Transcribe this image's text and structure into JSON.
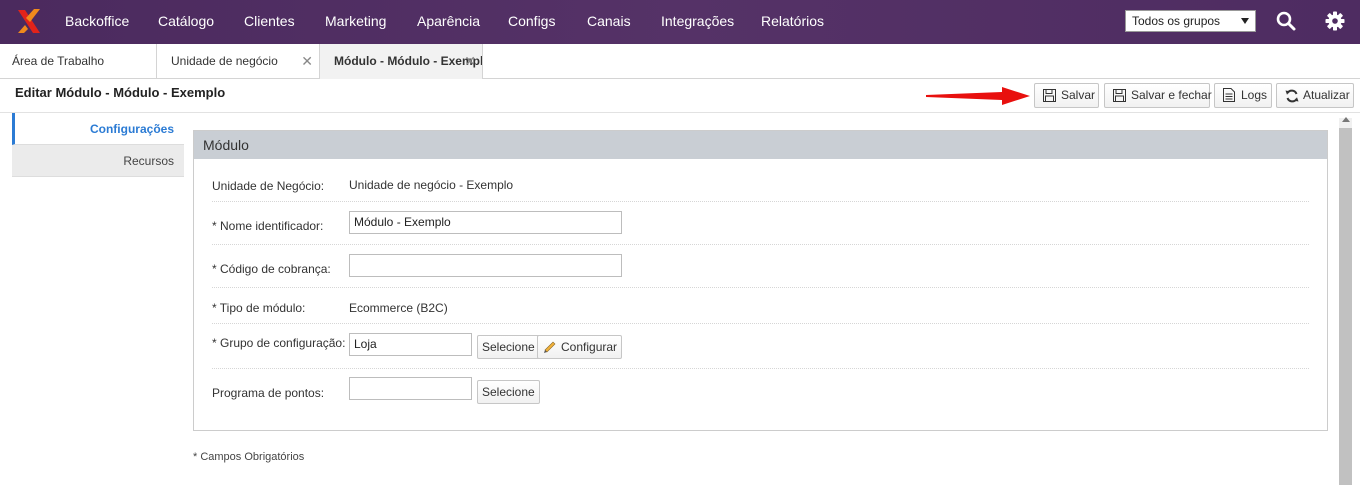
{
  "topnav": {
    "items": [
      "Backoffice",
      "Catálogo",
      "Clientes",
      "Marketing",
      "Aparência",
      "Configs",
      "Canais",
      "Integrações",
      "Relatórios"
    ],
    "group_select": "Todos os grupos"
  },
  "tabs": [
    {
      "label": "Área de Trabalho"
    },
    {
      "label": "Unidade de negócio",
      "close": "✕"
    },
    {
      "label": "Módulo - Módulo - Exemplo",
      "close": "✕"
    }
  ],
  "page": {
    "title": "Editar Módulo - Módulo - Exemplo"
  },
  "toolbar": {
    "save": "Salvar",
    "save_close": "Salvar e fechar",
    "logs": "Logs",
    "refresh": "Atualizar"
  },
  "leftmenu": {
    "items": [
      "Configurações",
      "Recursos"
    ]
  },
  "panel": {
    "title": "Módulo",
    "fields": {
      "unidade_label": "Unidade de Negócio:",
      "unidade_value": "Unidade de negócio - Exemplo",
      "nome_label": "* Nome identificador:",
      "nome_value": "Módulo - Exemplo",
      "codigo_label": "* Código de cobrança:",
      "codigo_value": "",
      "tipo_label": "* Tipo de módulo:",
      "tipo_value": "Ecommerce (B2C)",
      "grupo_label": "* Grupo de configuração:",
      "grupo_value": "Loja",
      "grupo_select_btn": "Selecione",
      "grupo_config_btn": "Configurar",
      "pontos_label": "Programa de pontos:",
      "pontos_value": "",
      "pontos_select_btn": "Selecione"
    }
  },
  "footnote": "* Campos Obrigatórios",
  "colors": {
    "topbar": "#4e2c61",
    "accent": "#2b7bd4",
    "panel_header": "#c9ced4",
    "arrow": "#e8100e",
    "logo_orange": "#f08a1c",
    "logo_red": "#e2231a"
  }
}
